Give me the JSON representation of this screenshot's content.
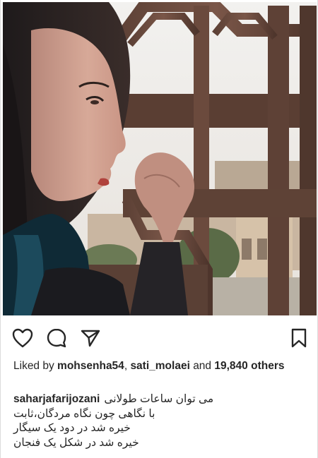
{
  "post": {
    "photo_alt": "",
    "actions": {
      "like_icon": "heart-icon",
      "comment_icon": "comment-icon",
      "share_icon": "paper-plane-icon",
      "save_icon": "bookmark-icon"
    },
    "likes": {
      "prefix": "Liked by",
      "users": [
        "mohsenha54",
        "sati_molaei"
      ],
      "separator": ",",
      "conjunction": "and",
      "count": "19,840",
      "suffix": "others"
    },
    "caption": {
      "username": "saharjafarijozani",
      "lines": [
        "می توان ساعات طولانی",
        "با نگاهی چون نگاه مردگان،ثابت",
        "خیره شد در دود یک سیگار",
        "خیره شد در شکل یک فنجان"
      ]
    }
  },
  "colors": {
    "text": "#262626",
    "icon": "#262626",
    "background": "#ffffff"
  }
}
